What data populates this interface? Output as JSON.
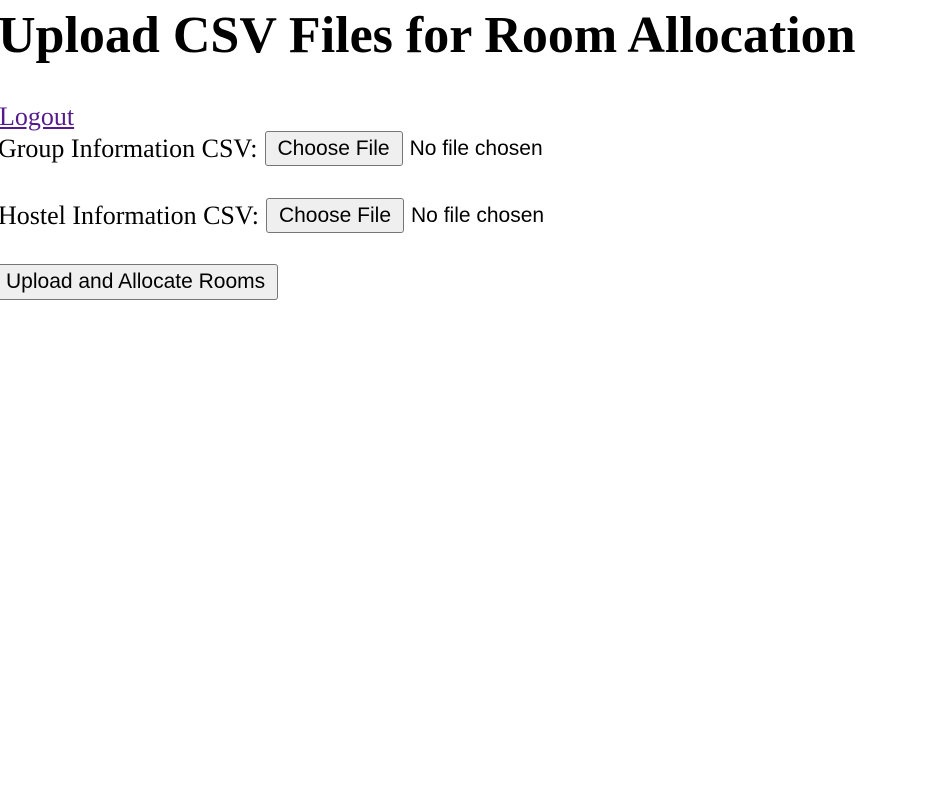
{
  "page": {
    "title": "Upload CSV Files for Room Allocation"
  },
  "nav": {
    "logout_label": "Logout"
  },
  "form": {
    "group_field": {
      "label": "Group Information CSV:",
      "button_label": "Choose File",
      "status": "No file chosen"
    },
    "hostel_field": {
      "label": "Hostel Information CSV:",
      "button_label": "Choose File",
      "status": "No file chosen"
    },
    "submit_label": "Upload and Allocate Rooms"
  },
  "colors": {
    "link_visited": "#551a8b",
    "button_bg": "#efefef",
    "button_border": "#767676"
  }
}
